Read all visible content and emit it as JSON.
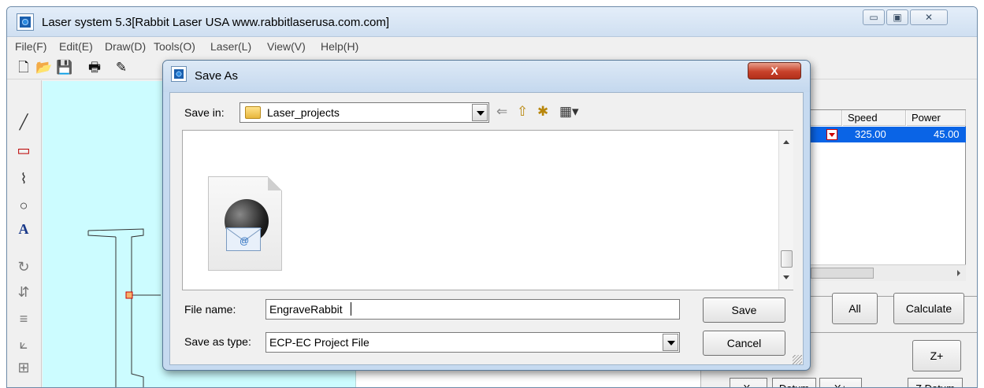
{
  "window": {
    "title": "Laser system 5.3[Rabbit Laser USA www.rabbitlaserusa.com.com]",
    "minimize_glyph": "▭",
    "maximize_glyph": "▣",
    "close_glyph": "✕"
  },
  "menubar": {
    "items": [
      "File(F)",
      "Edit(E)",
      "Draw(D)",
      "Tools(O)",
      "Laser(L)",
      "View(V)",
      "Help(H)"
    ]
  },
  "toolbar": {
    "icons": [
      "new-file-icon",
      "open-folder-icon",
      "save-disk-icon",
      "print-icon",
      "pencil-icon"
    ],
    "glyphs": [
      "🗋",
      "📂",
      "💾",
      "🖶",
      "✎"
    ]
  },
  "left_tools": {
    "icons": [
      "line-tool-icon",
      "rectangle-tool-icon",
      "polyline-tool-icon",
      "ellipse-tool-icon",
      "text-tool-icon",
      "rotate-tool-icon",
      "mirror-tool-icon",
      "align-tool-icon",
      "node-edit-icon",
      "array-tool-icon"
    ],
    "glyphs": [
      "╱",
      "▭",
      "⌇",
      "○",
      "A",
      "↻",
      "⇵",
      "≡",
      "⟀",
      "⊞"
    ]
  },
  "layers": {
    "columns": [
      "Speed",
      "Power"
    ],
    "rows": [
      {
        "speed": "325.00",
        "power": "45.00"
      }
    ]
  },
  "right_panel": {
    "all_label": "All",
    "calculate_label": "Calculate",
    "z_plus_label": "Z+",
    "x_minus_label": "X-",
    "datum_label": "Datum",
    "x_plus_label": "X+",
    "z_datum_label": "Z Datum"
  },
  "dialog": {
    "title": "Save As",
    "close_glyph": "X",
    "save_in_label": "Save in:",
    "save_in_value": "Laser_projects",
    "nav_glyphs": {
      "back": "⇐",
      "up": "⇧",
      "new_folder": "✱",
      "view_menu": "▦▾"
    },
    "file_name_label": "File name:",
    "file_name_value": "EngraveRabbit",
    "save_as_type_label": "Save as type:",
    "save_as_type_value": "ECP-EC Project File",
    "save_label": "Save",
    "cancel_label": "Cancel",
    "file_icon": "email-globe-file-icon"
  },
  "colors": {
    "canvas": "#ccfcff",
    "selection": "#0a64e6",
    "dialog_frame": "#c6daf0",
    "close_red": "#c7412a"
  }
}
